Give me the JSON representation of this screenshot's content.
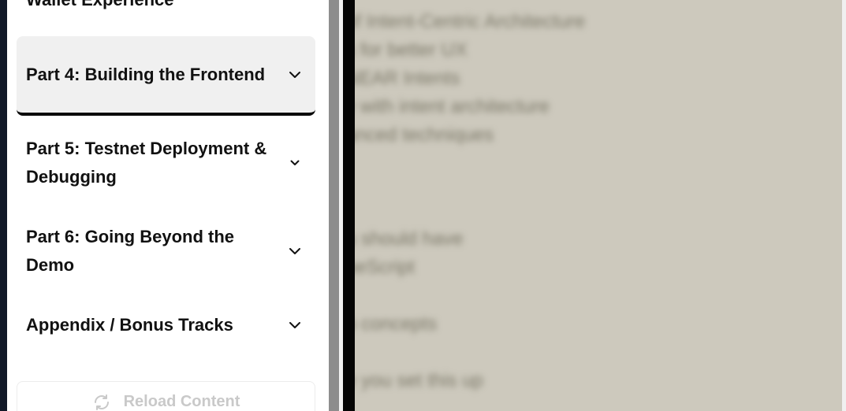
{
  "sidebar": {
    "partial_title": "Wallet Experience",
    "sections": [
      {
        "label": "Part 4: Building the Frontend",
        "expanded": false,
        "active": true
      },
      {
        "label": "Part 5: Testnet Deployment & Debugging",
        "expanded": false,
        "active": false
      },
      {
        "label": "Part 6: Going Beyond the Demo",
        "expanded": false,
        "active": false
      },
      {
        "label": "Appendix / Bonus Tracks",
        "expanded": false,
        "active": false
      }
    ],
    "reload_button": {
      "label": "Reload Content",
      "icon": "refresh-icon"
    }
  },
  "main": {
    "blurred_lines": [
      "of Intent-Centric Architecture",
      "s for better UX",
      "NEAR Intents",
      "y with intent architecture",
      "anced techniques",
      "u should have",
      "peScript",
      "b concepts",
      "e you set this up"
    ]
  },
  "colors": {
    "content_background": "#cdc9bd",
    "active_section_background": "#f0f0f0",
    "active_section_underline": "#0a0a0a"
  }
}
